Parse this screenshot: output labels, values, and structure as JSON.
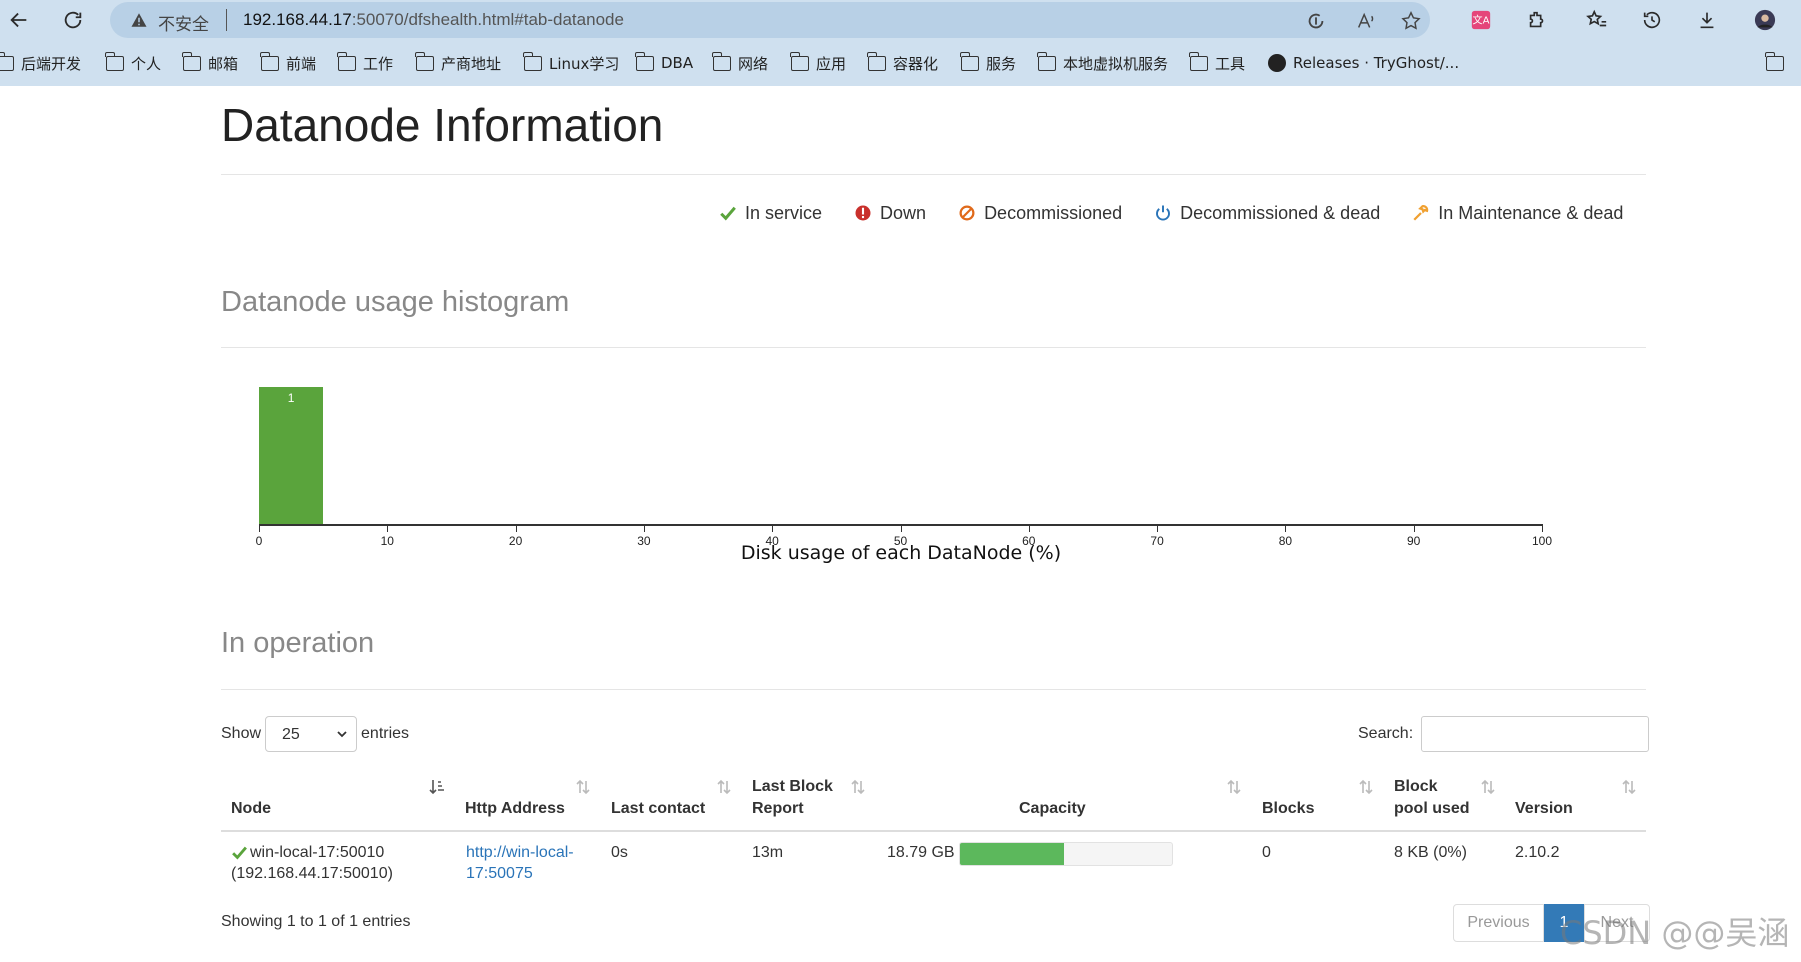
{
  "browser": {
    "not_secure": "不安全",
    "url_host": "192.168.44.17",
    "url_rest": ":50070/dfshealth.html#tab-datanode",
    "bookmarks": [
      "后端开发",
      "个人",
      "邮箱",
      "前端",
      "工作",
      "产商地址",
      "Linux学习",
      "DBA",
      "网络",
      "应用",
      "容器化",
      "服务",
      "本地虚拟机服务",
      "工具",
      "Releases · TryGhost/..."
    ]
  },
  "page": {
    "title": "Datanode Information",
    "legend": [
      {
        "label": "In service",
        "icon": "check-icon",
        "color": "#5aa43c"
      },
      {
        "label": "Down",
        "icon": "exclamation-circle-icon",
        "color": "#c9302c"
      },
      {
        "label": "Decommissioned",
        "icon": "ban-icon",
        "color": "#e06a1b"
      },
      {
        "label": "Decommissioned & dead",
        "icon": "power-icon",
        "color": "#2a74b8"
      },
      {
        "label": "In Maintenance & dead",
        "icon": "wrench-icon",
        "color": "#f0a030"
      }
    ]
  },
  "histogram": {
    "title": "Datanode usage histogram"
  },
  "chart_data": {
    "type": "bar",
    "xlabel": "Disk usage of each DataNode (%)",
    "xlim": [
      0,
      100
    ],
    "x_ticks": [
      "0",
      "10",
      "20",
      "30",
      "40",
      "50",
      "60",
      "70",
      "80",
      "90",
      "100"
    ],
    "bins": [
      {
        "from": 0,
        "to": 5,
        "count": 1
      }
    ],
    "bar_color": "#5aa43c"
  },
  "operation": {
    "title": "In operation",
    "show_label": "Show",
    "entries_label": "entries",
    "page_size": "25",
    "search_label": "Search:",
    "columns": {
      "node": "Node",
      "http": "Http Address",
      "last_contact": "Last contact",
      "last_block_l1": "Last Block",
      "last_block_l2": "Report",
      "capacity": "Capacity",
      "blocks": "Blocks",
      "pool_l1": "Block",
      "pool_l2": "pool used",
      "version": "Version"
    },
    "row": {
      "node_name": "win-local-17:50010",
      "node_addr": "(192.168.44.17:50010)",
      "http_l1": "http://win-local-",
      "http_l2": "17:50075",
      "last_contact": "0s",
      "last_block_report": "13m",
      "capacity": "18.79 GB",
      "capacity_used_fraction": 0.49,
      "blocks": "0",
      "block_pool_used": "8 KB (0%)",
      "version": "2.10.2"
    },
    "info": "Showing 1 to 1 of 1 entries",
    "pager": {
      "previous": "Previous",
      "current": "1",
      "next": "Next"
    }
  },
  "watermark": "CSDN @@吴涵"
}
